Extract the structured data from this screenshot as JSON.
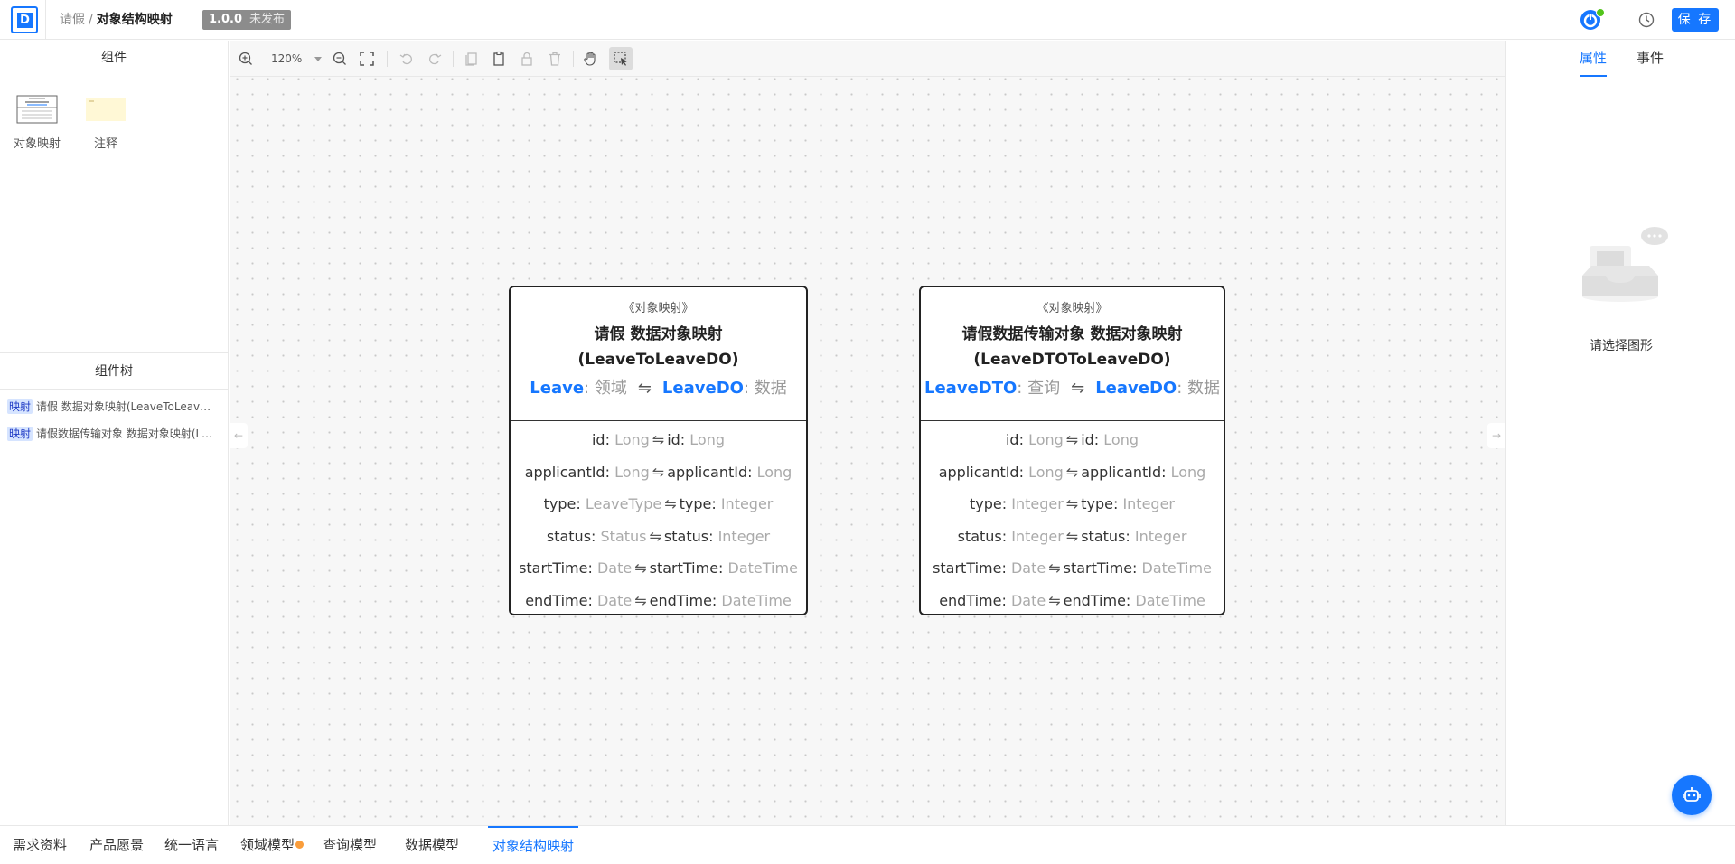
{
  "header": {
    "breadcrumb_parent": "请假",
    "breadcrumb_sep": "/",
    "breadcrumb_current": "对象结构映射",
    "version": "1.0.0",
    "version_status": "未发布",
    "save_label": "保 存"
  },
  "left": {
    "components_title": "组件",
    "components": [
      {
        "label": "对象映射",
        "icon": "object-mapping-thumb"
      },
      {
        "label": "注释",
        "icon": "note-thumb"
      }
    ],
    "tree_title": "组件树",
    "tree_items": [
      {
        "tag": "映射",
        "label": "请假 数据对象映射(LeaveToLeaveDO)"
      },
      {
        "tag": "映射",
        "label": "请假数据传输对象 数据对象映射(LeaveDTOToLeaveDO)"
      }
    ]
  },
  "toolbar": {
    "zoom": "120%",
    "icons": [
      "zoom-in-icon",
      "zoom-out-icon",
      "fit-screen-icon",
      "undo-icon",
      "redo-icon",
      "copy-icon",
      "paste-icon",
      "lock-icon",
      "delete-icon",
      "hand-icon",
      "select-icon"
    ]
  },
  "cards": [
    {
      "stereotype": "《对象映射》",
      "title_line1": "请假 数据对象映射",
      "title_line2": "(LeaveToLeaveDO)",
      "source_name": "Leave",
      "source_type": ": 领域",
      "arrow": "⇋",
      "target_name": "LeaveDO",
      "target_type": ": 数据",
      "fields": [
        {
          "src": "id:",
          "src_type": "Long",
          "dst": "id:",
          "dst_type": "Long"
        },
        {
          "src": "applicantId:",
          "src_type": "Long",
          "dst": "applicantId:",
          "dst_type": "Long"
        },
        {
          "src": "type:",
          "src_type": "LeaveType",
          "dst": "type:",
          "dst_type": "Integer"
        },
        {
          "src": "status:",
          "src_type": "Status",
          "dst": "status:",
          "dst_type": "Integer"
        },
        {
          "src": "startTime:",
          "src_type": "Date",
          "dst": "startTime:",
          "dst_type": "DateTime"
        },
        {
          "src": "endTime:",
          "src_type": "Date",
          "dst": "endTime:",
          "dst_type": "DateTime"
        }
      ]
    },
    {
      "stereotype": "《对象映射》",
      "title_line1": "请假数据传输对象 数据对象映射",
      "title_line2": "(LeaveDTOToLeaveDO)",
      "source_name": "LeaveDTO",
      "source_type": ": 查询",
      "arrow": "⇋",
      "target_name": "LeaveDO",
      "target_type": ": 数据",
      "fields": [
        {
          "src": "id:",
          "src_type": "Long",
          "dst": "id:",
          "dst_type": "Long"
        },
        {
          "src": "applicantId:",
          "src_type": "Long",
          "dst": "applicantId:",
          "dst_type": "Long"
        },
        {
          "src": "type:",
          "src_type": "Integer",
          "dst": "type:",
          "dst_type": "Integer"
        },
        {
          "src": "status:",
          "src_type": "Integer",
          "dst": "status:",
          "dst_type": "Integer"
        },
        {
          "src": "startTime:",
          "src_type": "Date",
          "dst": "startTime:",
          "dst_type": "DateTime"
        },
        {
          "src": "endTime:",
          "src_type": "Date",
          "dst": "endTime:",
          "dst_type": "DateTime"
        }
      ]
    }
  ],
  "right": {
    "tab_properties": "属性",
    "tab_events": "事件",
    "empty_text": "请选择图形"
  },
  "bottom_tabs": [
    {
      "label": "需求资料",
      "active": false,
      "dot": false
    },
    {
      "label": "产品愿景",
      "active": false,
      "dot": false
    },
    {
      "label": "统一语言",
      "active": false,
      "dot": false
    },
    {
      "label": "领域模型",
      "active": false,
      "dot": true
    },
    {
      "label": "查询模型",
      "active": false,
      "dot": false
    },
    {
      "label": "数据模型",
      "active": false,
      "dot": false
    },
    {
      "label": "对象结构映射",
      "active": true,
      "dot": false
    }
  ],
  "colors": {
    "accent": "#1677ff",
    "badge": "#8c8c8c",
    "dot": "#fa9d3b",
    "online": "#52c41a"
  }
}
